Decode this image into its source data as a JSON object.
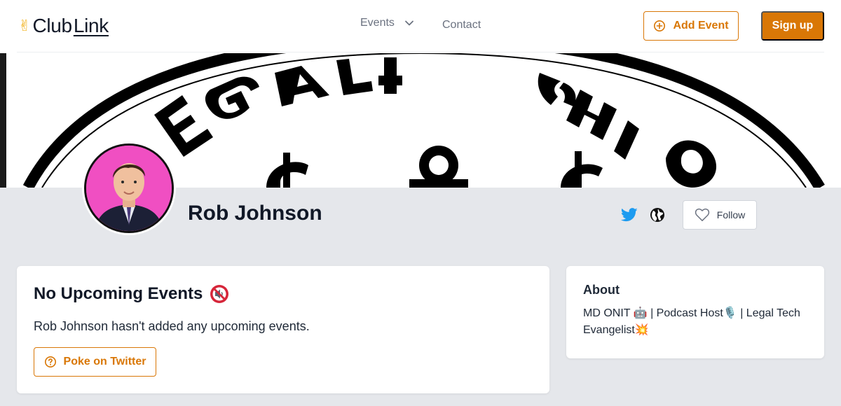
{
  "header": {
    "logo_emoji": "✌",
    "logo_club": "Club",
    "logo_link": "Link",
    "nav_events": "Events",
    "nav_contact": "Contact",
    "add_event_label": "Add Event",
    "signup_label": "Sign up"
  },
  "colors": {
    "accent": "#d97706",
    "page_background": "#e5e7eb",
    "twitter": "#1d9bf0",
    "avatar_background": "#f04fc2"
  },
  "profile": {
    "name": "Rob Johnson",
    "follow_label": "Follow",
    "social_icons": [
      "twitter-icon",
      "globe-icon"
    ]
  },
  "events": {
    "heading": "No Upcoming Events",
    "heading_icon": "muted-speaker-icon",
    "message": "Rob Johnson hasn't added any upcoming events.",
    "poke_label": "Poke on Twitter"
  },
  "about": {
    "heading": "About",
    "bio": "MD ONIT 🤖 | Podcast Host🎙️ | Legal Tech Evangelist💥"
  }
}
